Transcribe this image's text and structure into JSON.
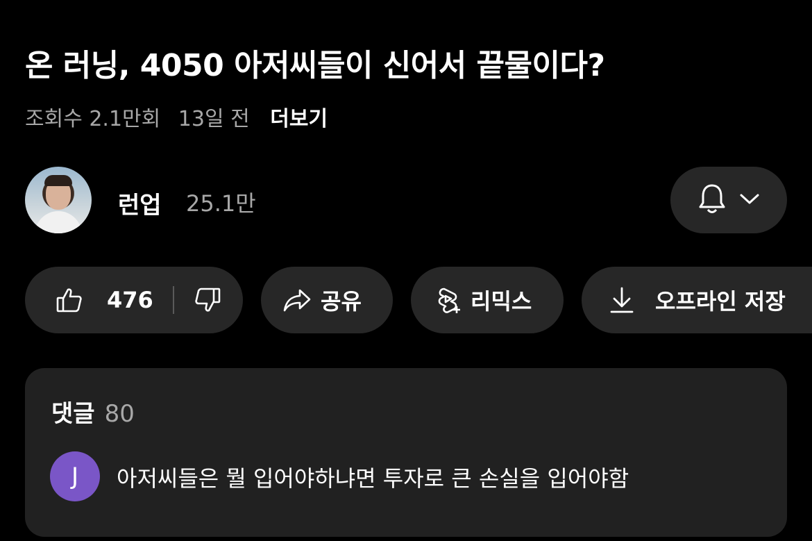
{
  "video": {
    "title": "온 러닝, 4050 아저씨들이 신어서 끝물이다?",
    "views": "조회수 2.1만회",
    "age": "13일 전",
    "more_label": "더보기"
  },
  "channel": {
    "name": "런업",
    "subscribers": "25.1만",
    "avatar_icon": "channel-avatar-photo",
    "notify_icon": "bell-icon",
    "dropdown_icon": "chevron-down-icon"
  },
  "actions": {
    "like_count": "476",
    "like_icon": "thumbs-up-icon",
    "dislike_icon": "thumbs-down-icon",
    "share_label": "공유",
    "share_icon": "share-arrow-icon",
    "remix_label": "리믹스",
    "remix_icon": "remix-icon",
    "offline_label": "오프라인 저장",
    "offline_icon": "download-icon"
  },
  "comments": {
    "label": "댓글",
    "count": "80",
    "top_comment": {
      "avatar_initial": "J",
      "avatar_color": "#7a56c7",
      "text": "아저씨들은 뭘 입어야하냐면 투자로 큰 손실을 입어야함"
    }
  },
  "colors": {
    "background": "#000000",
    "pill": "#272727",
    "panel": "#212121",
    "secondary_text": "#a8a8a8"
  }
}
